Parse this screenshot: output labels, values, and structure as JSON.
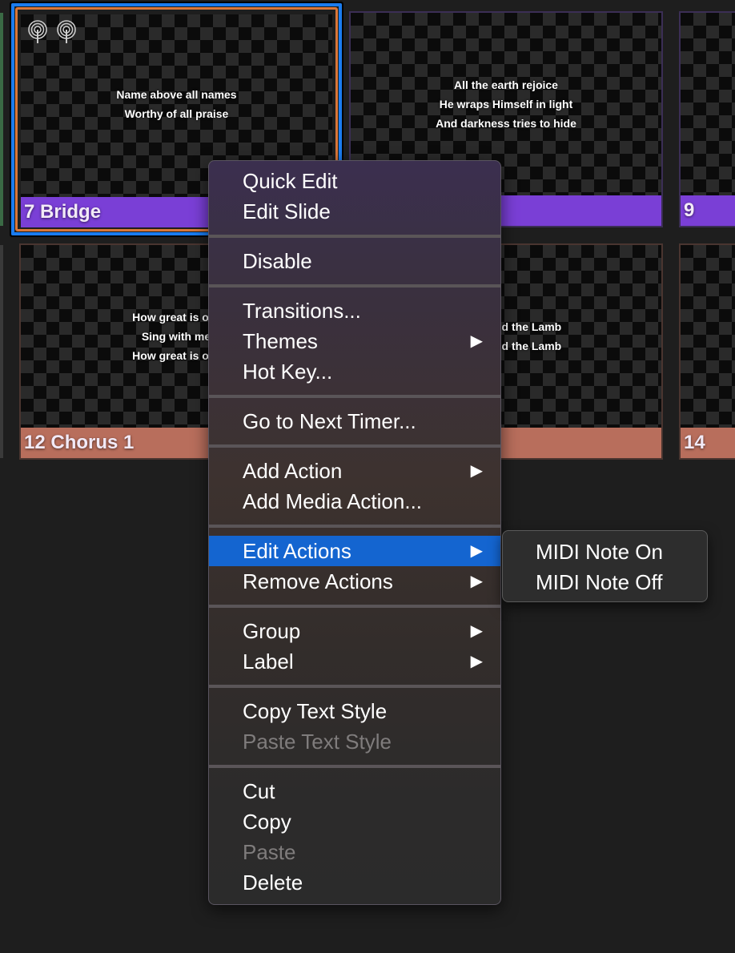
{
  "slides": [
    {
      "number": "7",
      "label": "Bridge",
      "lyrics": [
        "Name above all names",
        "Worthy of all praise"
      ],
      "color": "#7a3fd6",
      "selected": true,
      "icons": [
        "broadcast-icon",
        "broadcast-icon"
      ]
    },
    {
      "number": "",
      "label": "",
      "lyrics": [
        "All the earth rejoice",
        "He wraps Himself in light",
        "And darkness tries to hide"
      ],
      "color": "#7a3fd6"
    },
    {
      "number": "9",
      "label": "",
      "lyrics": [],
      "color": "#7a3fd6"
    },
    {
      "number": "12",
      "label": "Chorus 1",
      "lyrics": [
        "How great is our",
        "Sing with me",
        "How great is our"
      ],
      "color": "#b86e5c"
    },
    {
      "number": "",
      "label": "",
      "lyrics": [
        "nd the Lamb",
        "nd the Lamb"
      ],
      "color": "#b86e5c"
    },
    {
      "number": "14",
      "label": "",
      "lyrics": [],
      "color": "#b86e5c"
    }
  ],
  "context_menu": {
    "groups": [
      [
        {
          "label": "Quick Edit"
        },
        {
          "label": "Edit Slide"
        }
      ],
      [
        {
          "label": "Disable"
        }
      ],
      [
        {
          "label": "Transitions..."
        },
        {
          "label": "Themes",
          "submenu": true
        },
        {
          "label": "Hot Key..."
        }
      ],
      [
        {
          "label": "Go to Next Timer..."
        }
      ],
      [
        {
          "label": "Add Action",
          "submenu": true
        },
        {
          "label": "Add Media Action..."
        }
      ],
      [
        {
          "label": "Edit Actions",
          "submenu": true,
          "highlighted": true
        },
        {
          "label": "Remove Actions",
          "submenu": true
        }
      ],
      [
        {
          "label": "Group",
          "submenu": true
        },
        {
          "label": "Label",
          "submenu": true
        }
      ],
      [
        {
          "label": "Copy Text Style"
        },
        {
          "label": "Paste Text Style",
          "disabled": true
        }
      ],
      [
        {
          "label": "Cut"
        },
        {
          "label": "Copy"
        },
        {
          "label": "Paste",
          "disabled": true
        },
        {
          "label": "Delete"
        }
      ]
    ],
    "arrow": "▶",
    "highlight_color": "#1465d0"
  },
  "submenu": {
    "items": [
      {
        "label": "MIDI Note On"
      },
      {
        "label": "MIDI Note Off"
      }
    ]
  }
}
